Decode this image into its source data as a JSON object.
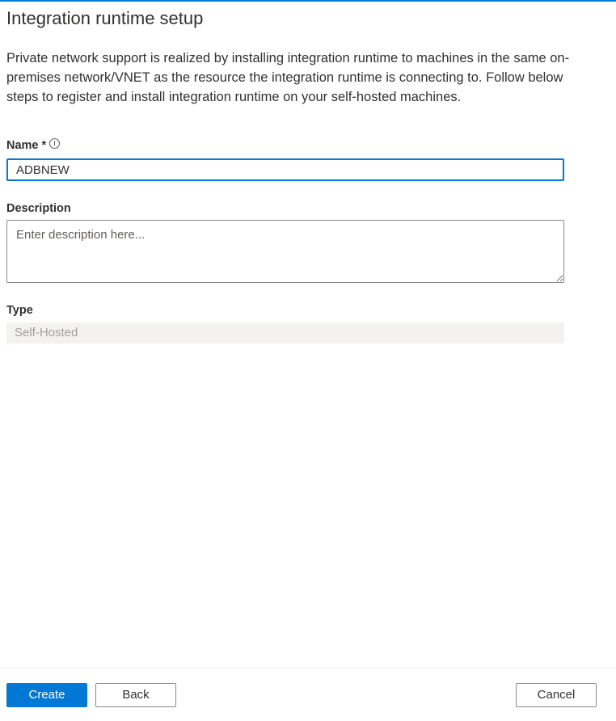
{
  "title": "Integration runtime setup",
  "description": "Private network support is realized by installing integration runtime to machines in the same on-premises network/VNET as the resource the integration runtime is connecting to. Follow below steps to register and install integration runtime on your self-hosted machines.",
  "name_field": {
    "label": "Name *",
    "info_icon": "i",
    "value": "ADBNEW"
  },
  "description_field": {
    "label": "Description",
    "placeholder": "Enter description here..."
  },
  "type_field": {
    "label": "Type",
    "value": "Self-Hosted"
  },
  "footer": {
    "create": "Create",
    "back": "Back",
    "cancel": "Cancel"
  },
  "colors": {
    "accent": "#0078d4"
  }
}
